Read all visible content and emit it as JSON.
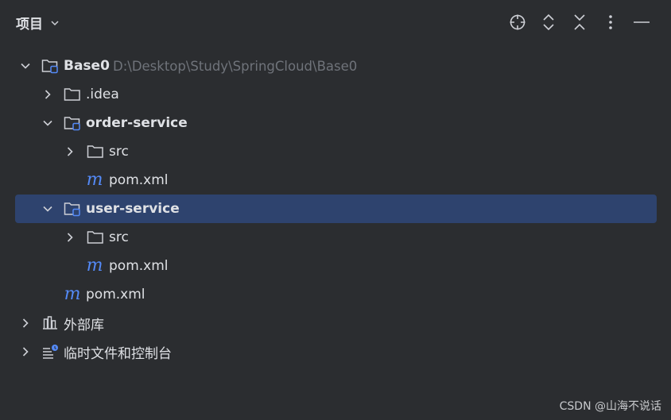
{
  "header": {
    "title": "项目",
    "tools": [
      "locate-icon",
      "expand-all-icon",
      "collapse-all-icon",
      "more-options-icon",
      "minimize-icon"
    ]
  },
  "tree": {
    "root": {
      "label": "Base0",
      "path": "D:\\Desktop\\Study\\SpringCloud\\Base0"
    },
    "idea": {
      "label": ".idea"
    },
    "order_service": {
      "label": "order-service",
      "src": "src",
      "pom": "pom.xml"
    },
    "user_service": {
      "label": "user-service",
      "src": "src",
      "pom": "pom.xml"
    },
    "root_pom": {
      "label": "pom.xml"
    },
    "external_libs": {
      "label": "外部库"
    },
    "scratches": {
      "label": "临时文件和控制台"
    }
  },
  "colors": {
    "background": "#2b2d30",
    "selection": "#2e436e",
    "maven_icon": "#548af7",
    "module_badge": "#548af7",
    "path_text": "#6f737a"
  },
  "watermark": "CSDN @山海不说话"
}
